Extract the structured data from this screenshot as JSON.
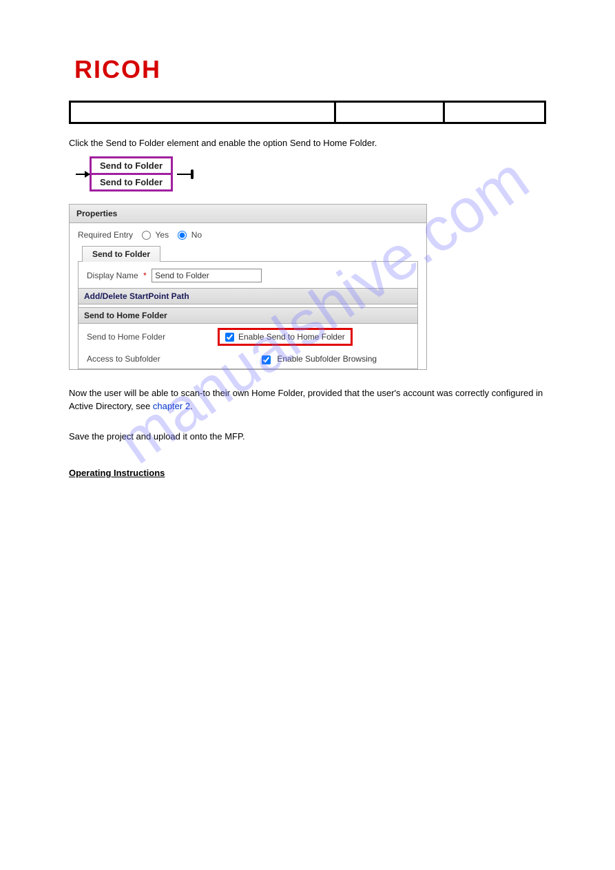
{
  "logo_text": "RICOH",
  "info_bar": {
    "c1": "",
    "c2": "",
    "c3": ""
  },
  "intro": "Click the Send to Folder element and enable the option Send to Home Folder.",
  "widget": {
    "row1": "Send to Folder",
    "row2": "Send to Folder"
  },
  "properties": {
    "title": "Properties",
    "required_entry": {
      "label": "Required Entry",
      "yes": "Yes",
      "no": "No",
      "value": "No"
    },
    "tab_label": "Send to Folder",
    "display_name_label": "Display Name",
    "display_name_value": "Send to Folder",
    "startpoint_section": "Add/Delete StartPoint Path",
    "send_home_section": "Send to Home Folder",
    "kv1": {
      "k": "Send to Home Folder",
      "v": "Enable Send to Home Folder"
    },
    "kv2": {
      "k": "Access to Subfolder",
      "v": "Enable Subfolder Browsing"
    }
  },
  "body1": "Now the user will be able to scan-to their own Home Folder, provided that the user's account was correctly configured in Active Directory, see ",
  "body1_link": "chapter 2",
  "body1_tail": ".",
  "body2": "Save the project and upload it onto the MFP.",
  "section_head": "Operating Instructions",
  "watermark": "manualshive.com"
}
